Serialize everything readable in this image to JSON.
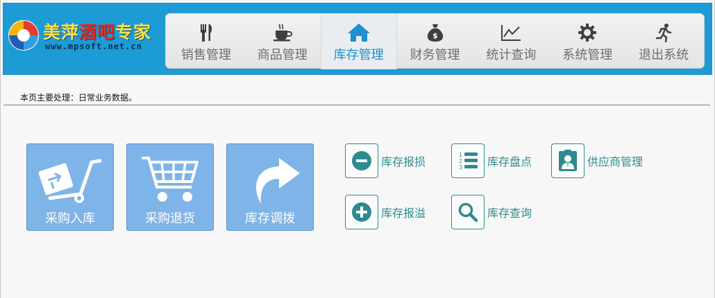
{
  "brand": {
    "title_part1": "美萍",
    "title_part2": "酒吧",
    "title_part3": "专家",
    "url": "www.mpsoft.net.cn"
  },
  "nav": {
    "items": [
      {
        "label": "销售管理",
        "icon": "fork-knife-icon"
      },
      {
        "label": "商品管理",
        "icon": "coffee-cup-icon"
      },
      {
        "label": "库存管理",
        "icon": "home-icon",
        "active": true
      },
      {
        "label": "财务管理",
        "icon": "money-bag-icon"
      },
      {
        "label": "统计查询",
        "icon": "line-chart-icon"
      },
      {
        "label": "系统管理",
        "icon": "gear-icon"
      },
      {
        "label": "退出系统",
        "icon": "running-man-icon"
      }
    ]
  },
  "page": {
    "note": "本页主要处理：日常业务数据。"
  },
  "tiles": [
    {
      "label": "采购入库",
      "icon": "hand-truck-icon"
    },
    {
      "label": "采购退货",
      "icon": "shopping-cart-icon"
    },
    {
      "label": "库存调拨",
      "icon": "curved-arrow-icon"
    }
  ],
  "quick_links": [
    {
      "label": "库存报损",
      "icon": "minus-circle-icon"
    },
    {
      "label": "库存盘点",
      "icon": "numbered-list-icon"
    },
    {
      "label": "供应商管理",
      "icon": "person-card-icon"
    },
    {
      "label": "库存报溢",
      "icon": "plus-circle-icon"
    },
    {
      "label": "库存查询",
      "icon": "magnifier-icon"
    }
  ],
  "colors": {
    "header_blue": "#1d9bd5",
    "active_nav_text": "#1e8fd0",
    "tile_blue": "#7fb4e8",
    "quick_teal": "#2f8a8f"
  }
}
